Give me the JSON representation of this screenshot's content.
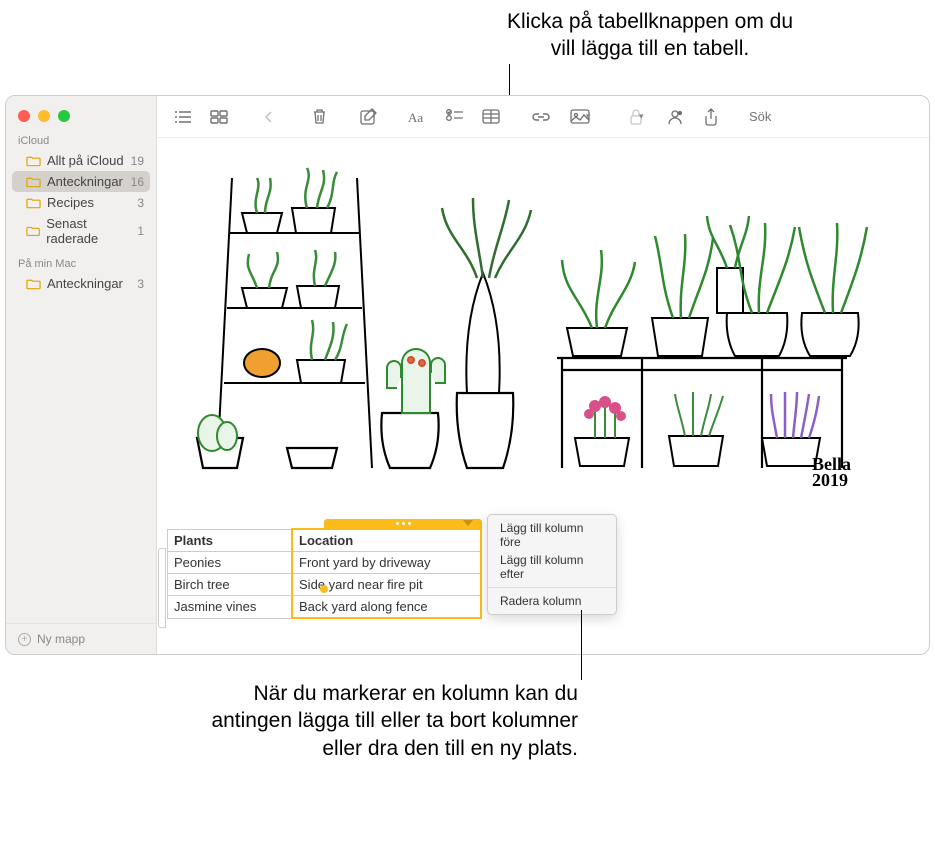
{
  "callouts": {
    "top": "Klicka på tabellknappen om du vill lägga till en tabell.",
    "bottom": "När du markerar en kolumn kan du antingen lägga till eller ta bort kolumner eller dra den till en ny plats."
  },
  "sidebar": {
    "sections": [
      {
        "header": "iCloud",
        "folders": [
          {
            "name": "Allt på iCloud",
            "count": "19"
          },
          {
            "name": "Anteckningar",
            "count": "16",
            "selected": true
          },
          {
            "name": "Recipes",
            "count": "3"
          },
          {
            "name": "Senast raderade",
            "count": "1"
          }
        ]
      },
      {
        "header": "På min Mac",
        "folders": [
          {
            "name": "Anteckningar",
            "count": "3"
          }
        ]
      }
    ],
    "new_folder_label": "Ny mapp"
  },
  "toolbar": {
    "search_placeholder": "Sök"
  },
  "note": {
    "signature_name": "Bella",
    "signature_year": "2019"
  },
  "table": {
    "headers": [
      "Plants",
      "Location"
    ],
    "rows": [
      [
        "Peonies",
        "Front yard by driveway"
      ],
      [
        "Birch tree",
        "Side yard near fire pit"
      ],
      [
        "Jasmine vines",
        "Back yard along fence"
      ]
    ]
  },
  "context_menu": {
    "items_group1": [
      "Lägg till kolumn före",
      "Lägg till kolumn efter"
    ],
    "items_group2": [
      "Radera kolumn"
    ]
  }
}
